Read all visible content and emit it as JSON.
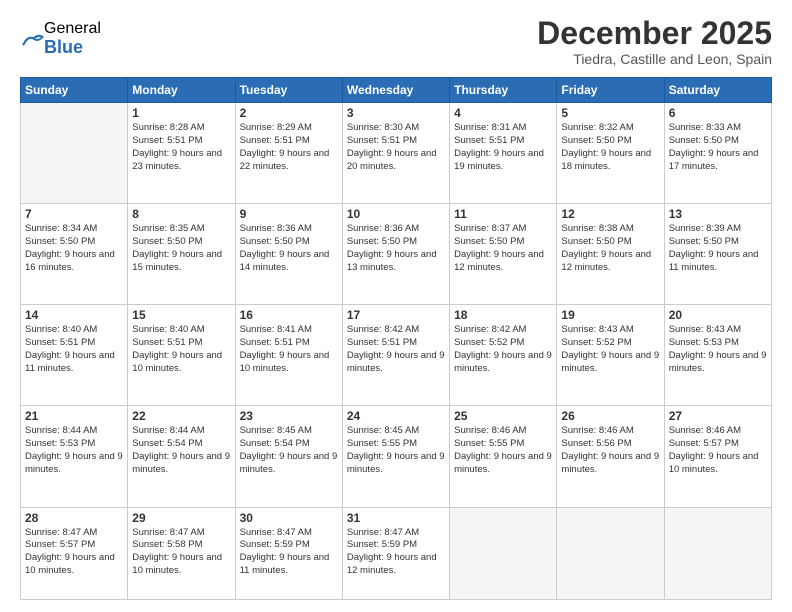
{
  "logo": {
    "general": "General",
    "blue": "Blue"
  },
  "title": {
    "month": "December 2025",
    "location": "Tiedra, Castille and Leon, Spain"
  },
  "weekdays": [
    "Sunday",
    "Monday",
    "Tuesday",
    "Wednesday",
    "Thursday",
    "Friday",
    "Saturday"
  ],
  "weeks": [
    [
      {
        "day": "",
        "sunrise": "",
        "sunset": "",
        "daylight": ""
      },
      {
        "day": "1",
        "sunrise": "Sunrise: 8:28 AM",
        "sunset": "Sunset: 5:51 PM",
        "daylight": "Daylight: 9 hours and 23 minutes."
      },
      {
        "day": "2",
        "sunrise": "Sunrise: 8:29 AM",
        "sunset": "Sunset: 5:51 PM",
        "daylight": "Daylight: 9 hours and 22 minutes."
      },
      {
        "day": "3",
        "sunrise": "Sunrise: 8:30 AM",
        "sunset": "Sunset: 5:51 PM",
        "daylight": "Daylight: 9 hours and 20 minutes."
      },
      {
        "day": "4",
        "sunrise": "Sunrise: 8:31 AM",
        "sunset": "Sunset: 5:51 PM",
        "daylight": "Daylight: 9 hours and 19 minutes."
      },
      {
        "day": "5",
        "sunrise": "Sunrise: 8:32 AM",
        "sunset": "Sunset: 5:50 PM",
        "daylight": "Daylight: 9 hours and 18 minutes."
      },
      {
        "day": "6",
        "sunrise": "Sunrise: 8:33 AM",
        "sunset": "Sunset: 5:50 PM",
        "daylight": "Daylight: 9 hours and 17 minutes."
      }
    ],
    [
      {
        "day": "7",
        "sunrise": "Sunrise: 8:34 AM",
        "sunset": "Sunset: 5:50 PM",
        "daylight": "Daylight: 9 hours and 16 minutes."
      },
      {
        "day": "8",
        "sunrise": "Sunrise: 8:35 AM",
        "sunset": "Sunset: 5:50 PM",
        "daylight": "Daylight: 9 hours and 15 minutes."
      },
      {
        "day": "9",
        "sunrise": "Sunrise: 8:36 AM",
        "sunset": "Sunset: 5:50 PM",
        "daylight": "Daylight: 9 hours and 14 minutes."
      },
      {
        "day": "10",
        "sunrise": "Sunrise: 8:36 AM",
        "sunset": "Sunset: 5:50 PM",
        "daylight": "Daylight: 9 hours and 13 minutes."
      },
      {
        "day": "11",
        "sunrise": "Sunrise: 8:37 AM",
        "sunset": "Sunset: 5:50 PM",
        "daylight": "Daylight: 9 hours and 12 minutes."
      },
      {
        "day": "12",
        "sunrise": "Sunrise: 8:38 AM",
        "sunset": "Sunset: 5:50 PM",
        "daylight": "Daylight: 9 hours and 12 minutes."
      },
      {
        "day": "13",
        "sunrise": "Sunrise: 8:39 AM",
        "sunset": "Sunset: 5:50 PM",
        "daylight": "Daylight: 9 hours and 11 minutes."
      }
    ],
    [
      {
        "day": "14",
        "sunrise": "Sunrise: 8:40 AM",
        "sunset": "Sunset: 5:51 PM",
        "daylight": "Daylight: 9 hours and 11 minutes."
      },
      {
        "day": "15",
        "sunrise": "Sunrise: 8:40 AM",
        "sunset": "Sunset: 5:51 PM",
        "daylight": "Daylight: 9 hours and 10 minutes."
      },
      {
        "day": "16",
        "sunrise": "Sunrise: 8:41 AM",
        "sunset": "Sunset: 5:51 PM",
        "daylight": "Daylight: 9 hours and 10 minutes."
      },
      {
        "day": "17",
        "sunrise": "Sunrise: 8:42 AM",
        "sunset": "Sunset: 5:51 PM",
        "daylight": "Daylight: 9 hours and 9 minutes."
      },
      {
        "day": "18",
        "sunrise": "Sunrise: 8:42 AM",
        "sunset": "Sunset: 5:52 PM",
        "daylight": "Daylight: 9 hours and 9 minutes."
      },
      {
        "day": "19",
        "sunrise": "Sunrise: 8:43 AM",
        "sunset": "Sunset: 5:52 PM",
        "daylight": "Daylight: 9 hours and 9 minutes."
      },
      {
        "day": "20",
        "sunrise": "Sunrise: 8:43 AM",
        "sunset": "Sunset: 5:53 PM",
        "daylight": "Daylight: 9 hours and 9 minutes."
      }
    ],
    [
      {
        "day": "21",
        "sunrise": "Sunrise: 8:44 AM",
        "sunset": "Sunset: 5:53 PM",
        "daylight": "Daylight: 9 hours and 9 minutes."
      },
      {
        "day": "22",
        "sunrise": "Sunrise: 8:44 AM",
        "sunset": "Sunset: 5:54 PM",
        "daylight": "Daylight: 9 hours and 9 minutes."
      },
      {
        "day": "23",
        "sunrise": "Sunrise: 8:45 AM",
        "sunset": "Sunset: 5:54 PM",
        "daylight": "Daylight: 9 hours and 9 minutes."
      },
      {
        "day": "24",
        "sunrise": "Sunrise: 8:45 AM",
        "sunset": "Sunset: 5:55 PM",
        "daylight": "Daylight: 9 hours and 9 minutes."
      },
      {
        "day": "25",
        "sunrise": "Sunrise: 8:46 AM",
        "sunset": "Sunset: 5:55 PM",
        "daylight": "Daylight: 9 hours and 9 minutes."
      },
      {
        "day": "26",
        "sunrise": "Sunrise: 8:46 AM",
        "sunset": "Sunset: 5:56 PM",
        "daylight": "Daylight: 9 hours and 9 minutes."
      },
      {
        "day": "27",
        "sunrise": "Sunrise: 8:46 AM",
        "sunset": "Sunset: 5:57 PM",
        "daylight": "Daylight: 9 hours and 10 minutes."
      }
    ],
    [
      {
        "day": "28",
        "sunrise": "Sunrise: 8:47 AM",
        "sunset": "Sunset: 5:57 PM",
        "daylight": "Daylight: 9 hours and 10 minutes."
      },
      {
        "day": "29",
        "sunrise": "Sunrise: 8:47 AM",
        "sunset": "Sunset: 5:58 PM",
        "daylight": "Daylight: 9 hours and 10 minutes."
      },
      {
        "day": "30",
        "sunrise": "Sunrise: 8:47 AM",
        "sunset": "Sunset: 5:59 PM",
        "daylight": "Daylight: 9 hours and 11 minutes."
      },
      {
        "day": "31",
        "sunrise": "Sunrise: 8:47 AM",
        "sunset": "Sunset: 5:59 PM",
        "daylight": "Daylight: 9 hours and 12 minutes."
      },
      {
        "day": "",
        "sunrise": "",
        "sunset": "",
        "daylight": ""
      },
      {
        "day": "",
        "sunrise": "",
        "sunset": "",
        "daylight": ""
      },
      {
        "day": "",
        "sunrise": "",
        "sunset": "",
        "daylight": ""
      }
    ]
  ]
}
